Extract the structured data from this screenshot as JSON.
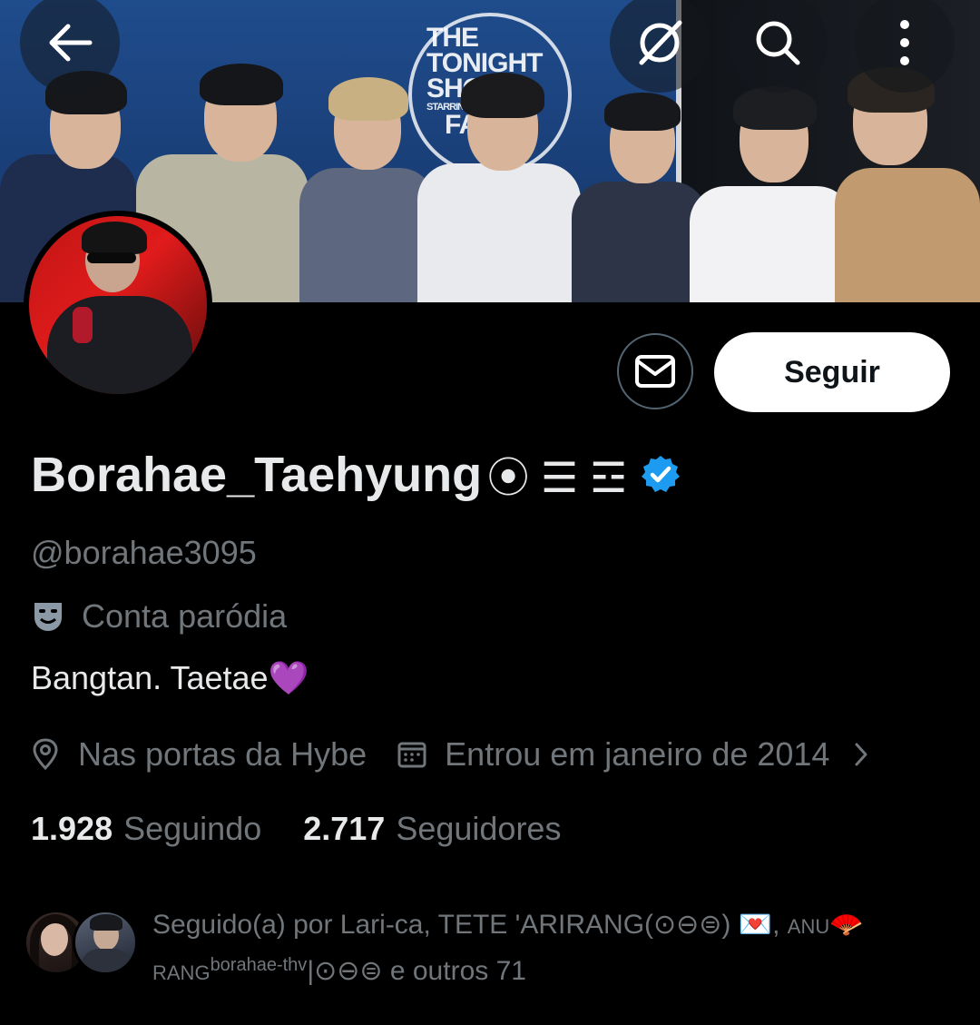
{
  "header": {
    "back_icon": "arrow-left-icon",
    "grok_icon": "grok-icon",
    "search_icon": "search-icon",
    "more_icon": "more-vertical-icon",
    "banner_sign": [
      "THE",
      "TONIGHT",
      "SHOW",
      "STARRING",
      "FA"
    ]
  },
  "profile": {
    "display_name": "Borahae_Taehyung",
    "name_suffix": "⦿ ☰ ☲",
    "verified": true,
    "handle": "@borahae3095",
    "parody_label": "Conta paródia",
    "bio": "Bangtan.  Taetae💜",
    "location": "Nas portas da Hybe",
    "joined": "Entrou em janeiro de 2014",
    "following_count": "1.928",
    "following_label": "Seguindo",
    "followers_count": "2.717",
    "followers_label": "Seguidores"
  },
  "actions": {
    "message_icon": "envelope-icon",
    "follow_label": "Seguir"
  },
  "followed_by": {
    "line1_a": "Seguido(a) por Lari-ca, TETE 'ARIRANG(⊙⊖⊜) 💌, ",
    "line1_b": "ANU",
    "line1_c": "🪭",
    "line2_a": "RANG",
    "line2_b": "borahae-thv",
    "line2_c": "|⊙⊖⊜ e outros 71"
  },
  "colors": {
    "background": "#000000",
    "text_primary": "#e7e9ea",
    "text_secondary": "#71767b",
    "verified_blue": "#1d9bf0",
    "button_white": "#ffffff"
  }
}
